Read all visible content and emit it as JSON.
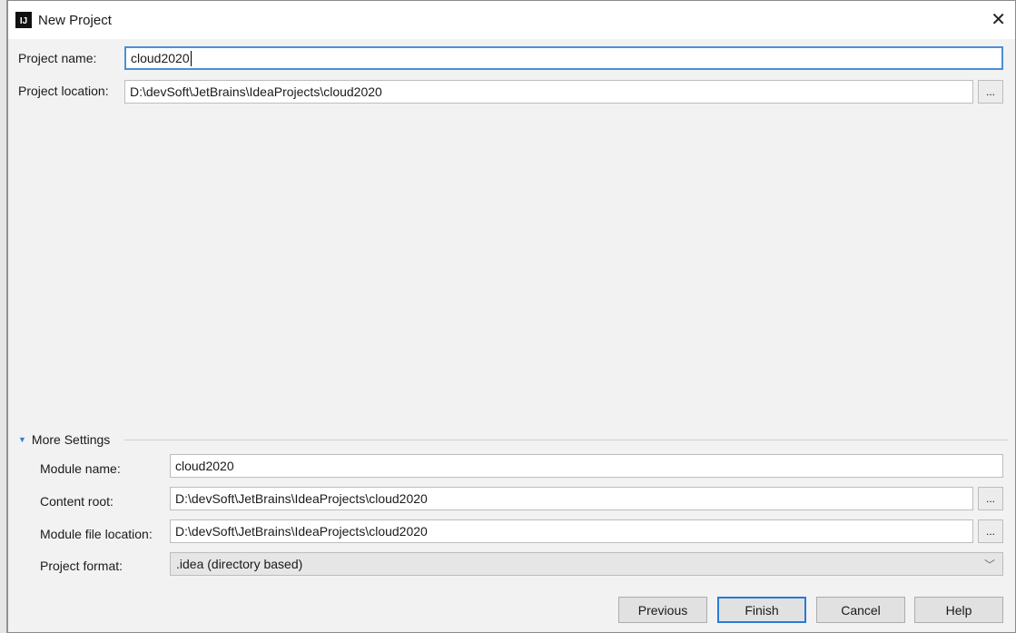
{
  "dialog": {
    "title": "New Project",
    "logo_text": "IJ"
  },
  "project": {
    "name_label": "Project name:",
    "name_value": "cloud2020",
    "location_label": "Project location:",
    "location_value": "D:\\devSoft\\JetBrains\\IdeaProjects\\cloud2020"
  },
  "more_settings": {
    "label": "More Settings",
    "module_name_label": "Module name:",
    "module_name_value": "cloud2020",
    "content_root_label": "Content root:",
    "content_root_value": "D:\\devSoft\\JetBrains\\IdeaProjects\\cloud2020",
    "module_file_label": "Module file location:",
    "module_file_value": "D:\\devSoft\\JetBrains\\IdeaProjects\\cloud2020",
    "format_label": "Project format:",
    "format_value": ".idea (directory based)"
  },
  "browse_label": "...",
  "buttons": {
    "previous": "Previous",
    "finish": "Finish",
    "cancel": "Cancel",
    "help": "Help"
  },
  "colors": {
    "accent": "#2a7ad5"
  }
}
